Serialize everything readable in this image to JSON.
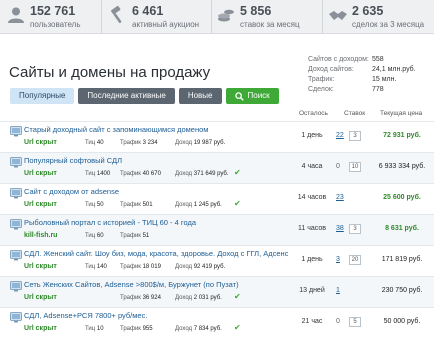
{
  "stats": [
    {
      "value": "152 761",
      "label": "пользователь",
      "icon": "user-icon"
    },
    {
      "value": "6 461",
      "label": "активный аукцион",
      "icon": "hammer-icon"
    },
    {
      "value": "5 856",
      "label": "ставок за месяц",
      "icon": "coins-icon"
    },
    {
      "value": "2 635",
      "label": "сделок за 3 месяца",
      "icon": "handshake-icon"
    }
  ],
  "page": {
    "title": "Сайты и домены на продажу"
  },
  "side_info": {
    "rows": [
      {
        "k": "Сайтов с доходом:",
        "v": "558"
      },
      {
        "k": "Доход сайтов:",
        "v": "24,1 млн.руб."
      },
      {
        "k": "Трафик:",
        "v": "15 млн."
      },
      {
        "k": "Сделок:",
        "v": "778"
      }
    ]
  },
  "tabs": [
    {
      "label": "Популярные",
      "active": true
    },
    {
      "label": "Последние активные",
      "active": false
    },
    {
      "label": "Новые",
      "active": false
    },
    {
      "label": "Поиск",
      "active": false,
      "icon": "search-icon"
    }
  ],
  "table": {
    "headers": {
      "left": "Осталось",
      "bids": "Ставок",
      "price": "Текущая цена"
    }
  },
  "lots": [
    {
      "title": "Старый доходный сайт с запоминающимся доменом",
      "url": "Url скрыт",
      "tic": "40",
      "traffic": "3 234",
      "income": "19 987 руб.",
      "verified": false,
      "time_left": "1 день",
      "bids": "22",
      "bidbox": "3",
      "price": "72 931 руб.",
      "price_green": true
    },
    {
      "title": "Популярный софтовый СДЛ",
      "url": "Url скрыт",
      "tic": "1400",
      "traffic": "40 670",
      "income": "371 649 руб.",
      "verified": true,
      "time_left": "4 часа",
      "bids": "0",
      "bidbox": "10",
      "price": "6 933 334 руб.",
      "price_green": false
    },
    {
      "title": "Сайт с доходом от adsense",
      "url": "Url скрыт",
      "tic": "50",
      "traffic": "501",
      "income": "1 245 руб.",
      "verified": true,
      "time_left": "14 часов",
      "bids": "23",
      "bidbox": "",
      "price": "25 600 руб.",
      "price_green": true
    },
    {
      "title": "Рыболовный портал с историей - ТИЦ 60 - 4 года",
      "url": "kill-fish.ru",
      "tic": "60",
      "traffic": "51",
      "income": "",
      "verified": false,
      "time_left": "11 часов",
      "bids": "38",
      "bidbox": "3",
      "price": "8 631 руб.",
      "price_green": true
    },
    {
      "title": "СДЛ. Женский сайт. Шоу биз, мода, красота, здоровье. Доход с ГГЛ, Адсенс",
      "url": "Url скрыт",
      "tic": "140",
      "traffic": "18 019",
      "income": "92 419 руб.",
      "verified": false,
      "time_left": "1 день",
      "bids": "3",
      "bidbox": "20",
      "price": "171 819 руб.",
      "price_green": false
    },
    {
      "title": "Сеть Женских Сайтов, Adsense >800$/м, Буржунет (по Пузат)",
      "url": "Url скрыт",
      "tic": "",
      "traffic": "36 924",
      "income": "2 031 руб.",
      "verified": true,
      "time_left": "13 дней",
      "bids": "1",
      "bidbox": "",
      "price": "230 750 руб.",
      "price_green": false
    },
    {
      "title": "СДЛ, Adsense+РСЯ 7800+ руб/мес.",
      "url": "Url скрыт",
      "tic": "10",
      "traffic": "955",
      "income": "7 834 руб.",
      "verified": true,
      "time_left": "21 час",
      "bids": "0",
      "bidbox": "5",
      "price": "50 000 руб.",
      "price_green": false
    }
  ],
  "labels": {
    "tic": "Тиц",
    "traffic": "Трафик",
    "income": "Доход"
  },
  "colors": {
    "link": "#1d5d95",
    "green": "#2f8a2b",
    "accent_green": "#3ea936",
    "tab_dark": "#5b6670",
    "tab_active": "#cfe4f5"
  }
}
